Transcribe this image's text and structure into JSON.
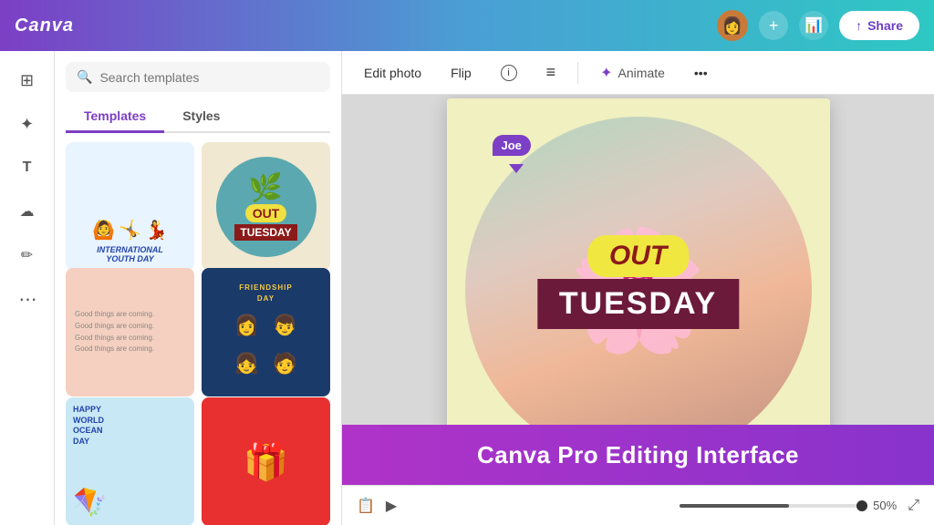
{
  "header": {
    "logo": "Canva",
    "share_label": "Share",
    "add_icon": "+",
    "analytics_icon": "📊"
  },
  "sidebar": {
    "icons": [
      {
        "name": "grid-icon",
        "symbol": "⊞",
        "label": "Grid"
      },
      {
        "name": "elements-icon",
        "symbol": "✦",
        "label": "Elements"
      },
      {
        "name": "text-icon",
        "symbol": "T",
        "label": "Text"
      },
      {
        "name": "upload-icon",
        "symbol": "⬆",
        "label": "Upload"
      },
      {
        "name": "draw-icon",
        "symbol": "✏",
        "label": "Draw"
      },
      {
        "name": "apps-icon",
        "symbol": "⋯",
        "label": "Apps"
      }
    ]
  },
  "templates_panel": {
    "search_placeholder": "Search templates",
    "tabs": [
      {
        "label": "Templates",
        "active": true
      },
      {
        "label": "Styles",
        "active": false
      }
    ],
    "cards": [
      {
        "id": "youth",
        "title": "International Youth Day"
      },
      {
        "id": "tuesday",
        "title": "Out Tuesday"
      },
      {
        "id": "good-things",
        "title": "Good Things Are Coming"
      },
      {
        "id": "friendship",
        "title": "Friendship Day"
      },
      {
        "id": "ocean",
        "title": "Happy World Ocean Day"
      },
      {
        "id": "gift",
        "title": "Gift"
      }
    ]
  },
  "toolbar": {
    "edit_photo": "Edit photo",
    "flip": "Flip",
    "info_icon": "ℹ",
    "align_icon": "≡",
    "animate": "Animate",
    "more_icon": "•••"
  },
  "canvas": {
    "design_text_out": "OUT",
    "design_text_tuesday": "TUESDAY",
    "collaborator_name": "Joe"
  },
  "bottom_bar": {
    "zoom_label": "50%",
    "progress_value": 60
  },
  "promo_banner": {
    "text": "Canva Pro Editing Interface"
  }
}
